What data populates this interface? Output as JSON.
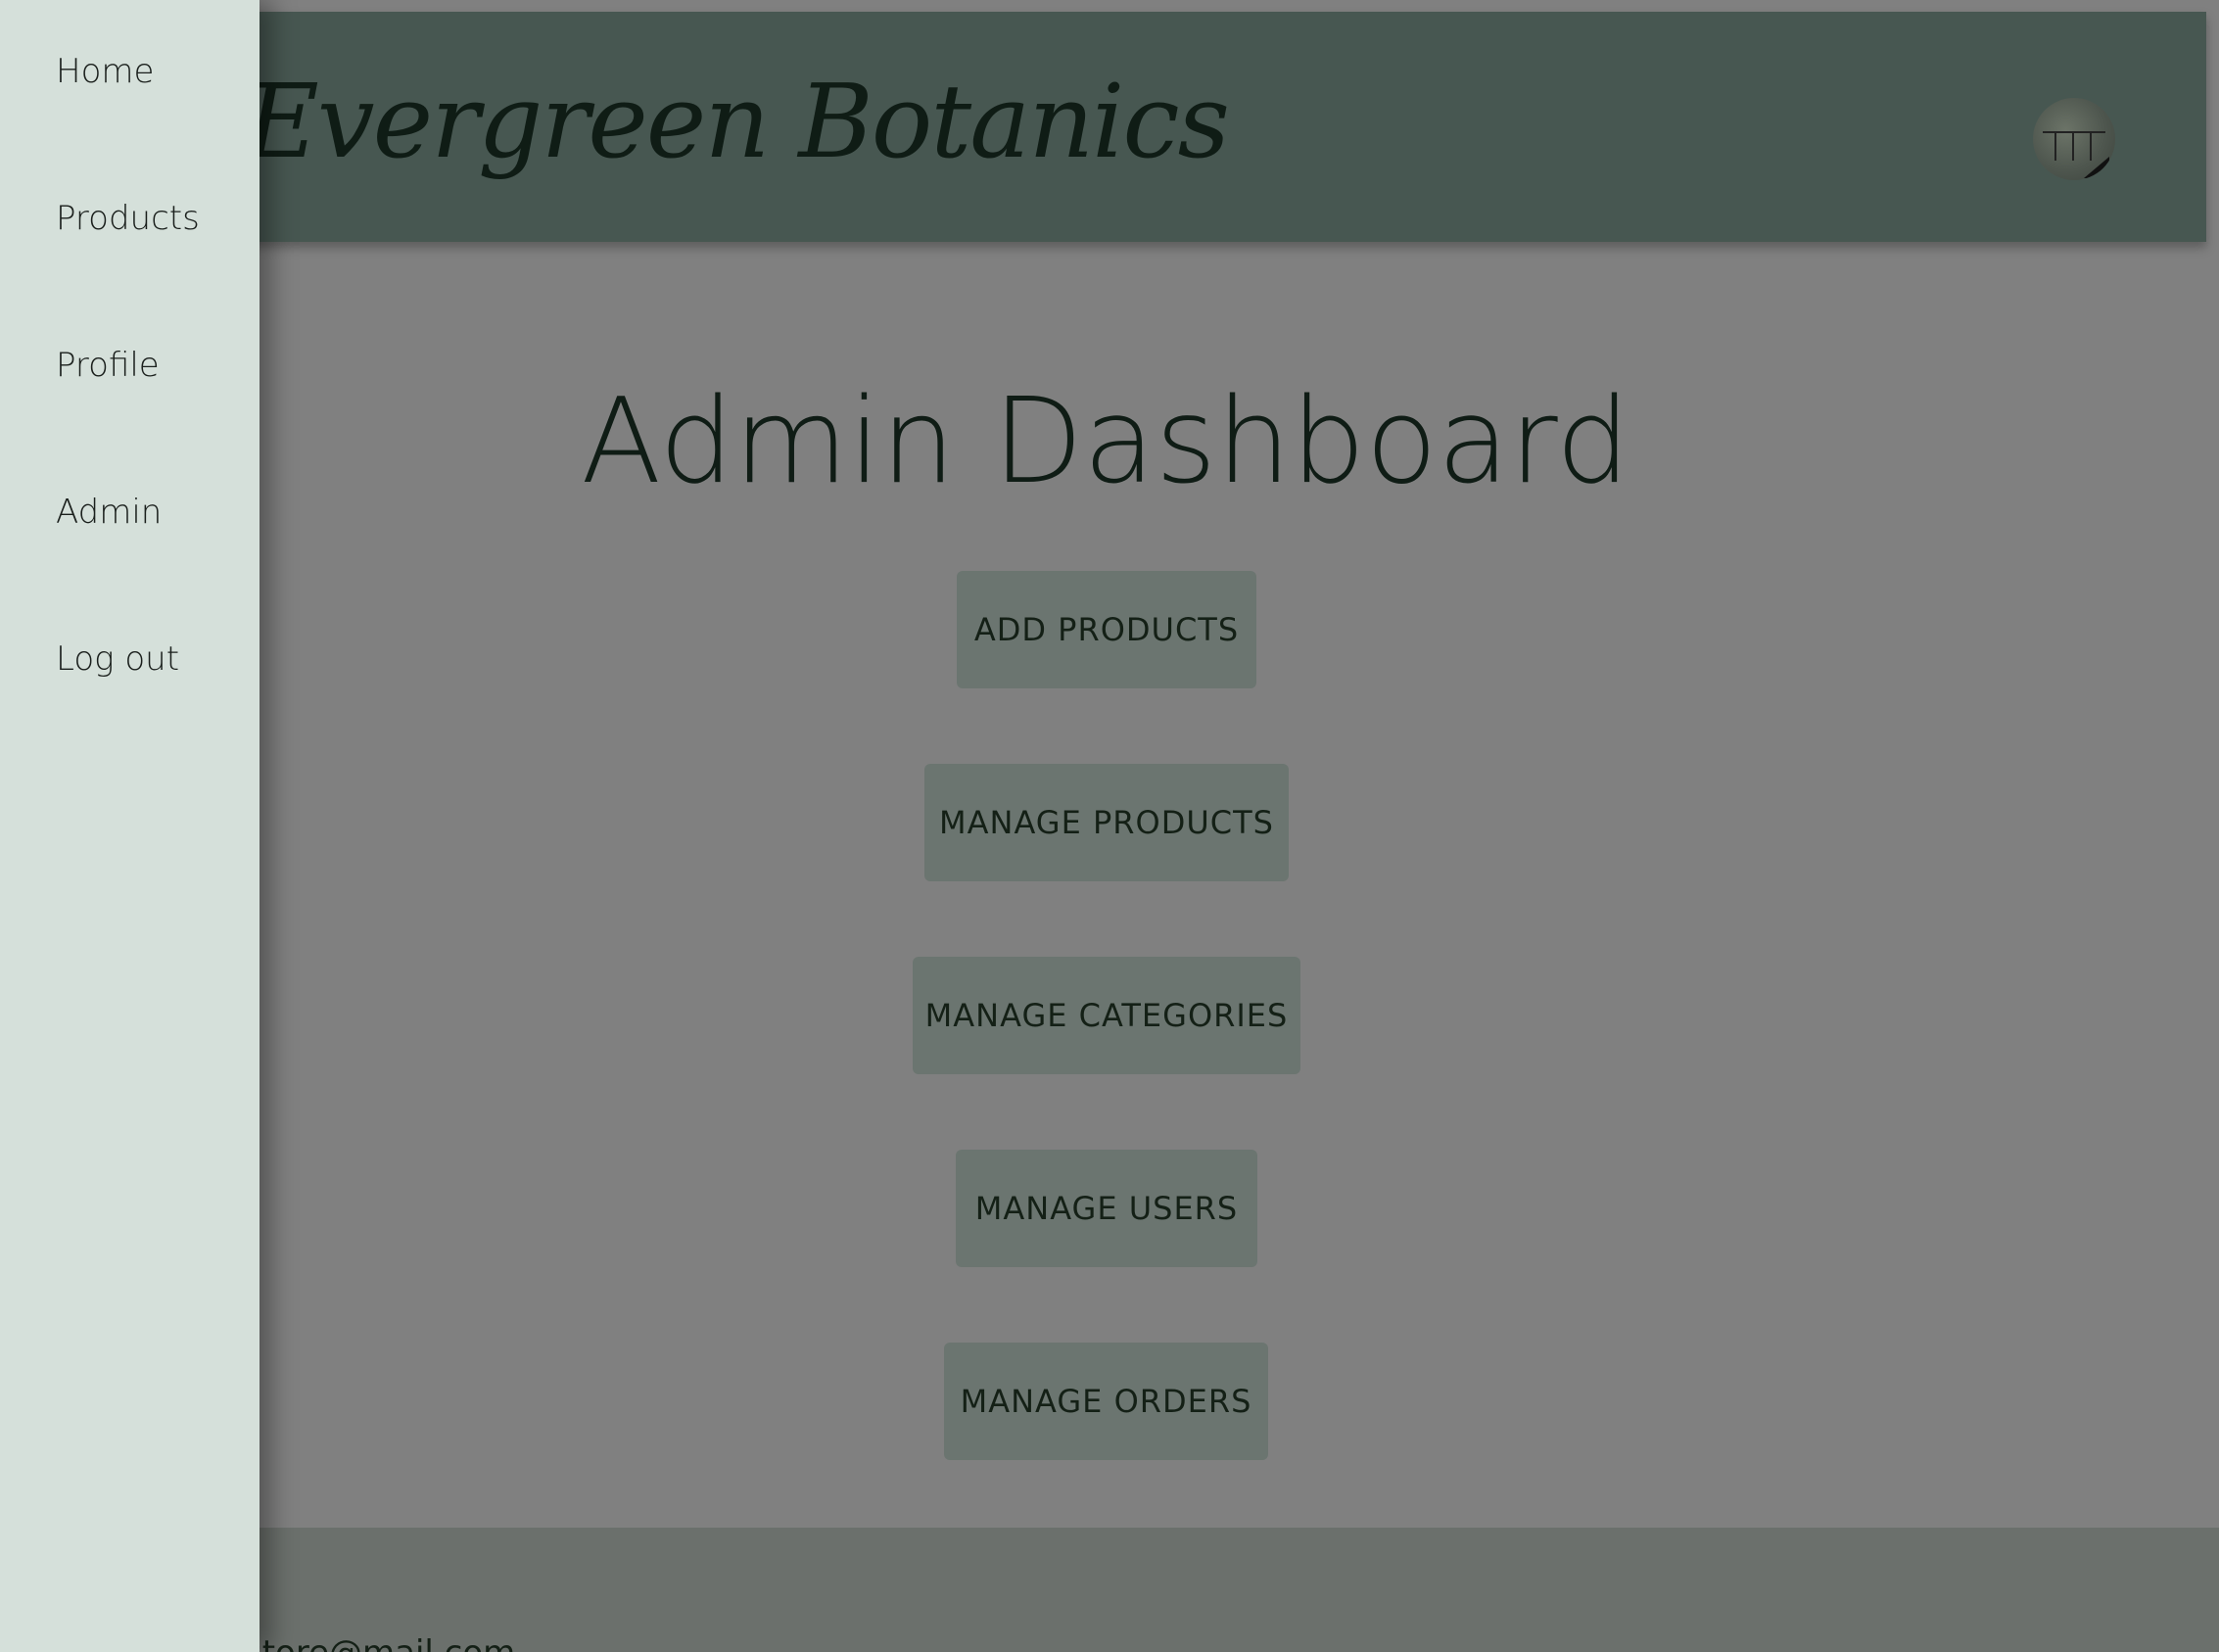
{
  "header": {
    "brand": "Evergreen Botanics",
    "avatar_alt": "user-avatar"
  },
  "main": {
    "title": "Admin Dashboard",
    "actions": [
      {
        "label": "ADD PRODUCTS"
      },
      {
        "label": "MANAGE PRODUCTS"
      },
      {
        "label": "MANAGE CATEGORIES"
      },
      {
        "label": "MANAGE USERS"
      },
      {
        "label": "MANAGE ORDERS"
      }
    ]
  },
  "footer": {
    "email_text": "store@mail.com"
  },
  "drawer": {
    "items": [
      {
        "label": "Home"
      },
      {
        "label": "Products"
      },
      {
        "label": "Profile"
      },
      {
        "label": "Admin"
      },
      {
        "label": "Log out"
      }
    ]
  },
  "colors": {
    "header_bg": "#475751",
    "drawer_bg": "#d5e0da",
    "overlay_bg": "#808080",
    "button_bg": "#6b7570",
    "text_dark": "#0f1c15"
  }
}
